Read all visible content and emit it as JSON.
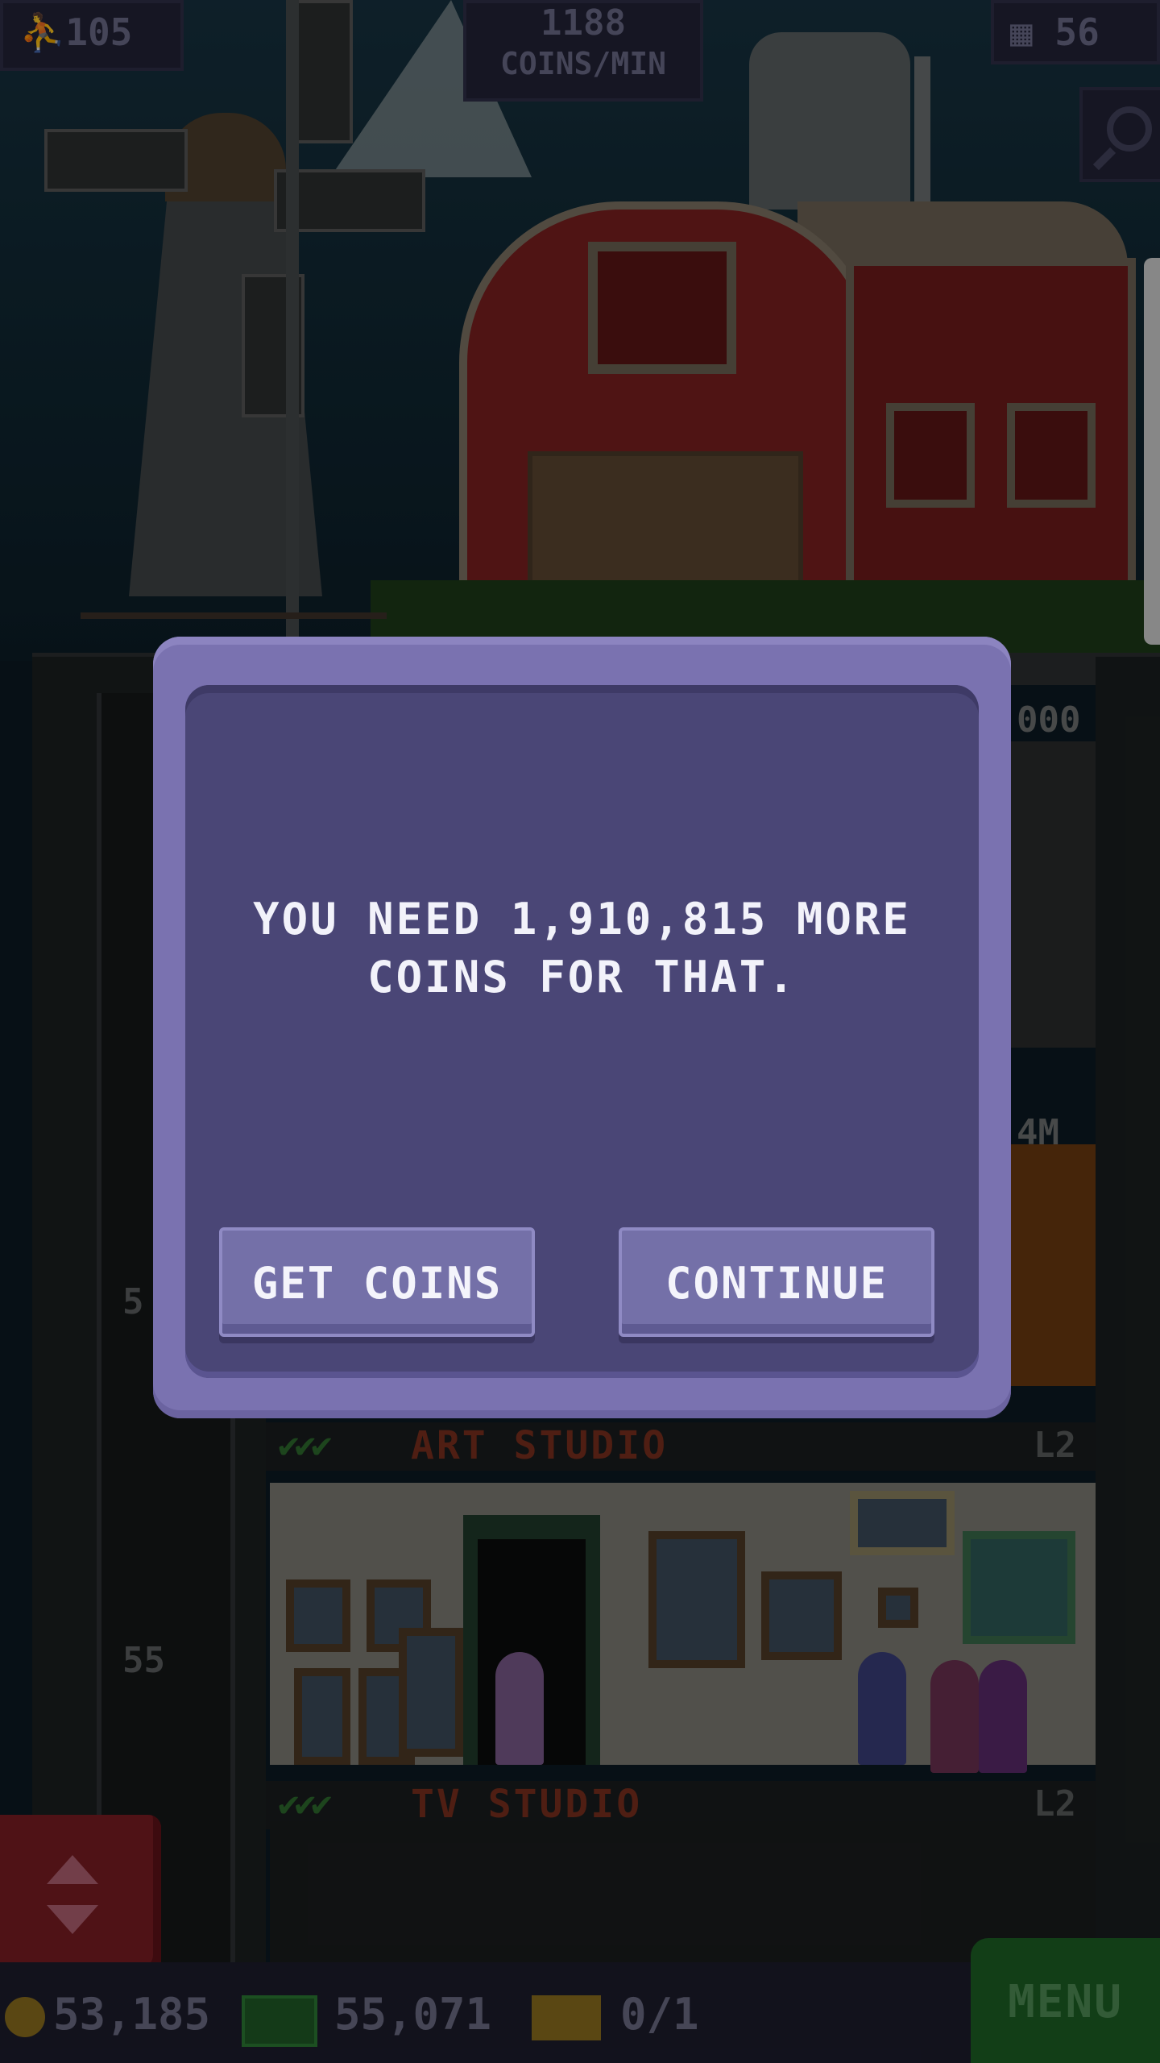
{
  "hud": {
    "population": "105",
    "coins_rate_value": "1188",
    "coins_rate_unit": "COINS/MIN",
    "floors": "56"
  },
  "tower": {
    "upper_floor_value_1": "000",
    "upper_floor_value_2": "4M",
    "level_number_a": "5",
    "level_number_b": "55",
    "floors": [
      {
        "name": "ART STUDIO",
        "level": "L2"
      },
      {
        "name": "TV STUDIO",
        "level": "L2"
      }
    ]
  },
  "dialog": {
    "message": "YOU NEED 1,910,815 MORE COINS FOR THAT.",
    "get_coins_label": "GET COINS",
    "continue_label": "CONTINUE"
  },
  "bottom_bar": {
    "coins": "53,185",
    "bux": "55,071",
    "tickets": "0/1",
    "menu_label": "MENU"
  },
  "colors": {
    "dialog_outer": "#7a72b0",
    "dialog_inner": "#4a4676",
    "button": "#7470a8",
    "menu_green": "#1c6024",
    "elevator_red": "#7a1c22"
  }
}
